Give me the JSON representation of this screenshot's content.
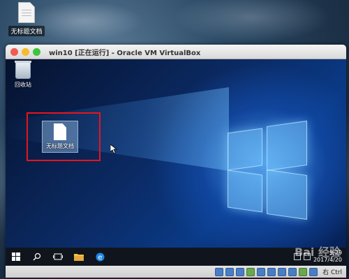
{
  "host_desktop": {
    "file_icon_label": "无标题文档"
  },
  "window": {
    "title": "win10 [正在运行] - Oracle VM VirtualBox"
  },
  "guest_desktop": {
    "recycle_bin_label": "回收站",
    "doc_icon_label": "无标题文档",
    "highlight_color": "#e8141c"
  },
  "taskbar": {
    "time": "9:29",
    "date": "2017/4/20",
    "icons": [
      "windows-start-icon",
      "search-icon",
      "task-view-icon",
      "file-explorer-icon",
      "edge-browser-icon"
    ]
  },
  "statusbar": {
    "host_key": "右 Ctrl"
  },
  "watermark": "Bai 经验"
}
